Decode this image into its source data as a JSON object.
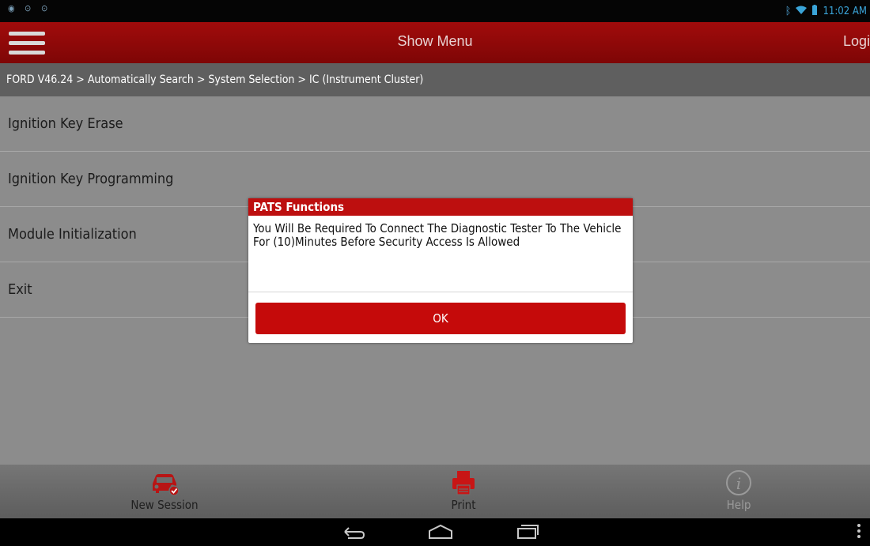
{
  "status_bar": {
    "left_icons": [
      "target-icon",
      "camera-icon",
      "camera-icon"
    ],
    "time": "11:02 AM"
  },
  "app_bar": {
    "title": "Show Menu",
    "login_label": "Logi"
  },
  "breadcrumb": "FORD V46.24 > Automatically Search > System Selection > IC (Instrument Cluster)",
  "menu_items": [
    {
      "label": "Ignition Key Erase"
    },
    {
      "label": "Ignition Key Programming"
    },
    {
      "label": "Module Initialization"
    },
    {
      "label": "Exit"
    }
  ],
  "dialog": {
    "title": "PATS Functions",
    "message": "You Will Be Required To Connect The Diagnostic Tester To The Vehicle For (10)Minutes Before Security Access Is Allowed",
    "ok_label": "OK"
  },
  "toolbar": {
    "new_session": "New Session",
    "print": "Print",
    "help": "Help"
  },
  "colors": {
    "accent": "#bd0f0f",
    "app_bar": "#8f0909",
    "disabled": "#9a9a9a"
  }
}
